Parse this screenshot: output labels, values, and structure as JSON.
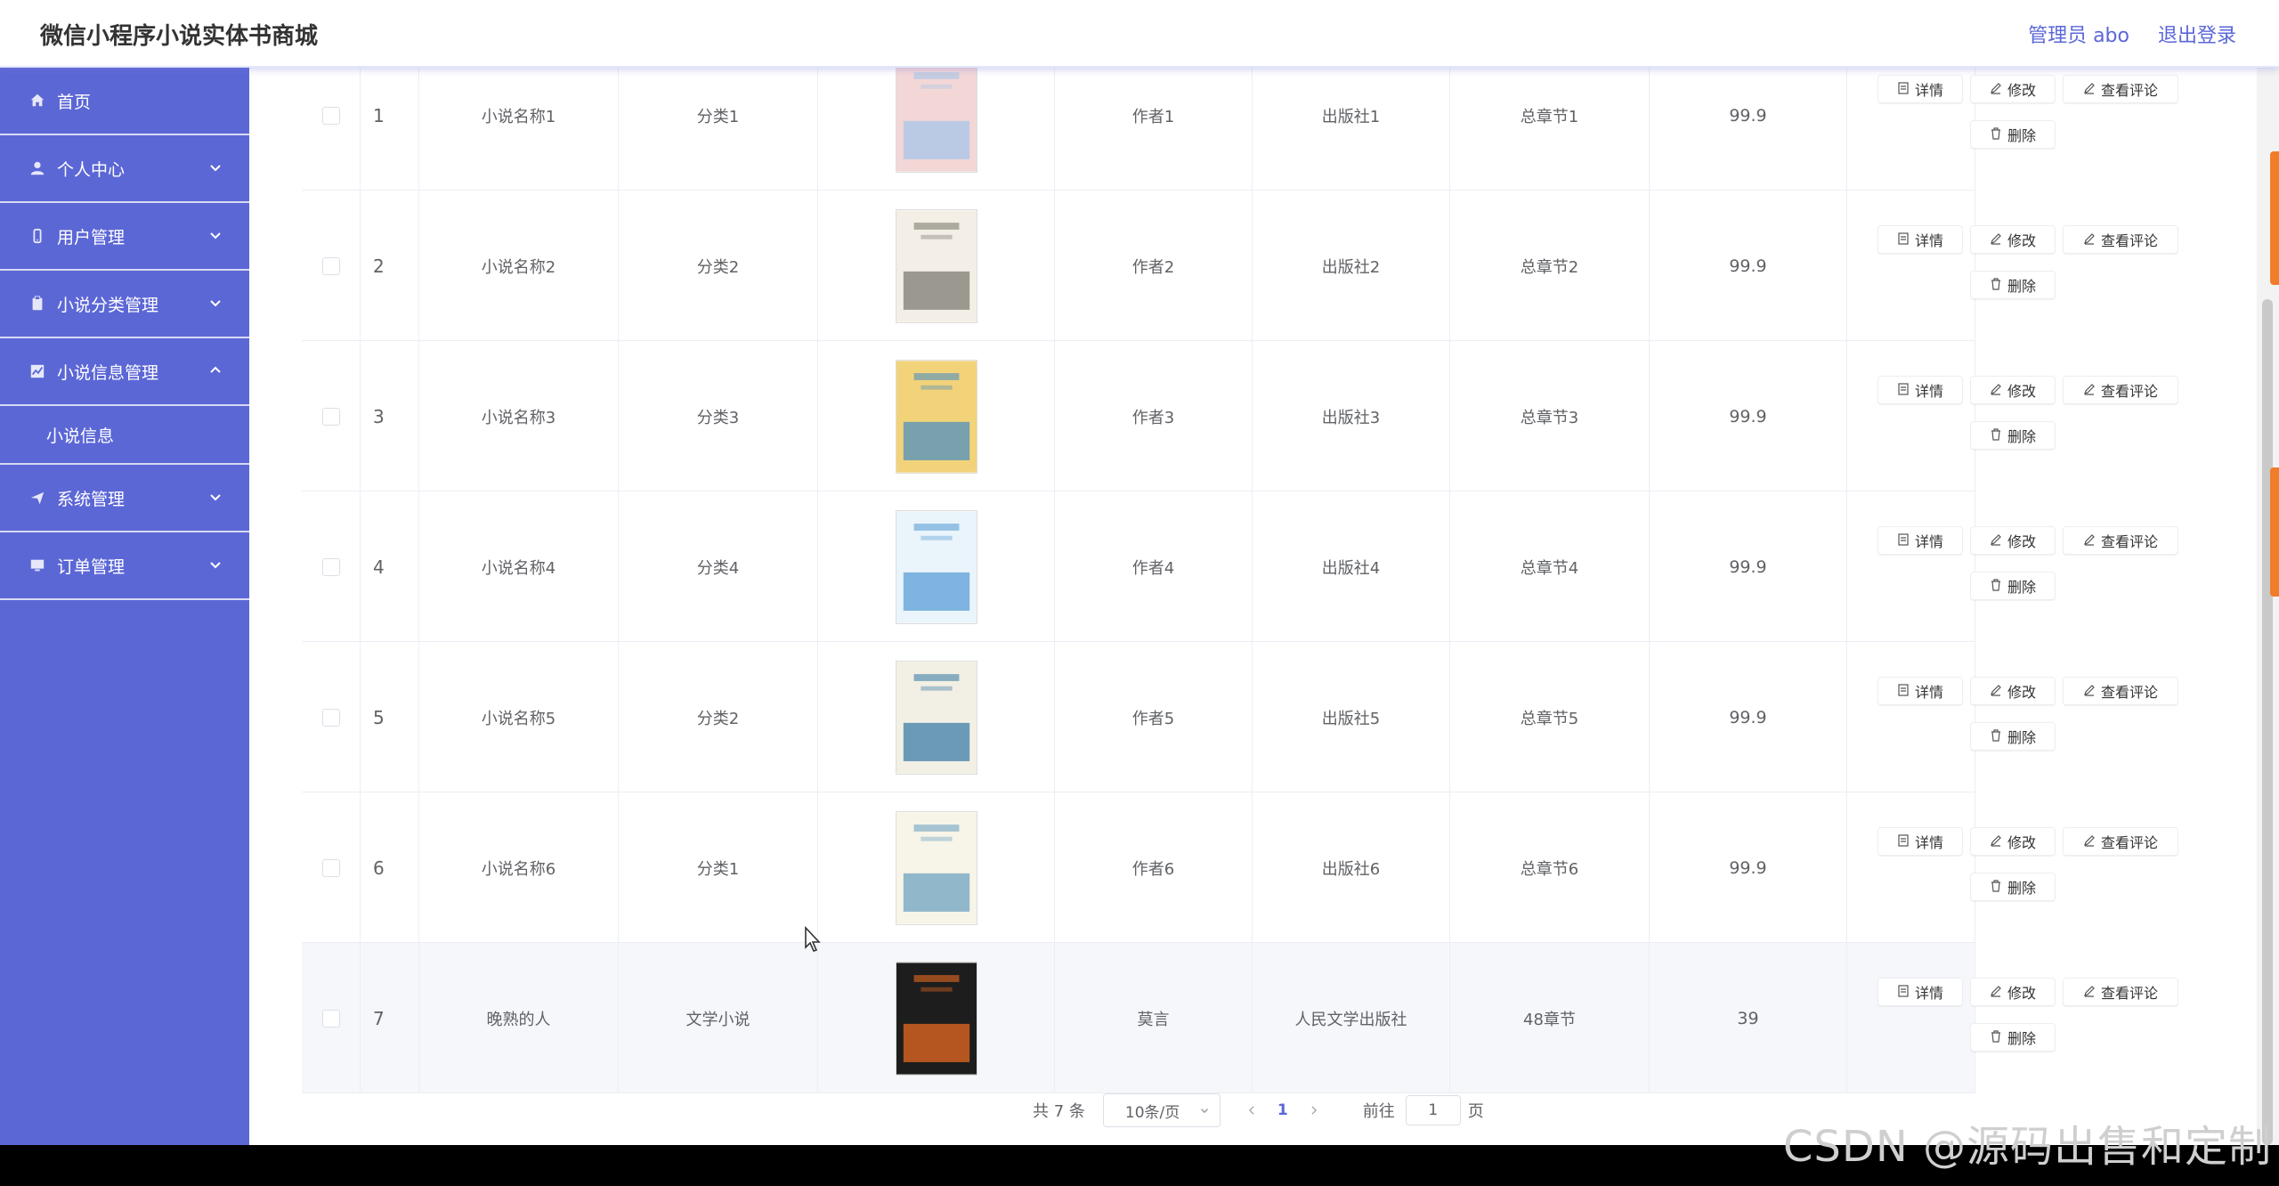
{
  "header": {
    "title": "微信小程序小说实体书商城",
    "admin_label": "管理员 abo",
    "logout_label": "退出登录"
  },
  "sidebar": {
    "items": [
      {
        "label": "首页",
        "icon": "home-icon"
      },
      {
        "label": "个人中心",
        "icon": "user-icon"
      },
      {
        "label": "用户管理",
        "icon": "phone-icon"
      },
      {
        "label": "小说分类管理",
        "icon": "clipboard-icon"
      },
      {
        "label": "小说信息管理",
        "icon": "chart-icon",
        "expanded": true,
        "sub": [
          "小说信息"
        ]
      },
      {
        "label": "系统管理",
        "icon": "send-icon"
      },
      {
        "label": "订单管理",
        "icon": "monitor-icon"
      }
    ]
  },
  "table": {
    "rows": [
      {
        "index": "1",
        "name": "小说名称1",
        "category": "分类1",
        "author": "作者1",
        "publisher": "出版社1",
        "chapters": "总章节1",
        "price": "99.9",
        "cover_colors": [
          "#f3d7d7",
          "#a8c6e8"
        ]
      },
      {
        "index": "2",
        "name": "小说名称2",
        "category": "分类2",
        "author": "作者2",
        "publisher": "出版社2",
        "chapters": "总章节2",
        "price": "99.9",
        "cover_colors": [
          "#f4efe6",
          "#7d7b72"
        ]
      },
      {
        "index": "3",
        "name": "小说名称3",
        "category": "分类3",
        "author": "作者3",
        "publisher": "出版社3",
        "chapters": "总章节3",
        "price": "99.9",
        "cover_colors": [
          "#f2d37a",
          "#4f8fbf"
        ]
      },
      {
        "index": "4",
        "name": "小说名称4",
        "category": "分类4",
        "author": "作者4",
        "publisher": "出版社4",
        "chapters": "总章节4",
        "price": "99.9",
        "cover_colors": [
          "#eaf4fb",
          "#5a9fd6"
        ]
      },
      {
        "index": "5",
        "name": "小说名称5",
        "category": "分类2",
        "author": "作者5",
        "publisher": "出版社5",
        "chapters": "总章节5",
        "price": "99.9",
        "cover_colors": [
          "#f2efe4",
          "#3e7ea8"
        ]
      },
      {
        "index": "6",
        "name": "小说名称6",
        "category": "分类1",
        "author": "作者6",
        "publisher": "出版社6",
        "chapters": "总章节6",
        "price": "99.9",
        "cover_colors": [
          "#f7f4e8",
          "#6fa3c2"
        ]
      },
      {
        "index": "7",
        "name": "晚熟的人",
        "category": "文学小说",
        "author": "莫言",
        "publisher": "人民文学出版社",
        "chapters": "48章节",
        "price": "39",
        "cover_colors": [
          "#1d1d1d",
          "#e86a22"
        ]
      }
    ],
    "highlighted_row": 6,
    "actions": {
      "detail": "详情",
      "edit": "修改",
      "comments": "查看评论",
      "delete": "删除"
    }
  },
  "pagination": {
    "total_label": "共 7 条",
    "page_size": "10条/页",
    "current_page": "1",
    "goto_label": "前往",
    "goto_value": "1",
    "page_suffix": "页"
  },
  "watermark": "CSDN @源码出售和定制",
  "colors": {
    "sidebar_bg": "#5c67d6",
    "accent": "#5b67d9",
    "highlight_row": "#f5f7fa"
  }
}
